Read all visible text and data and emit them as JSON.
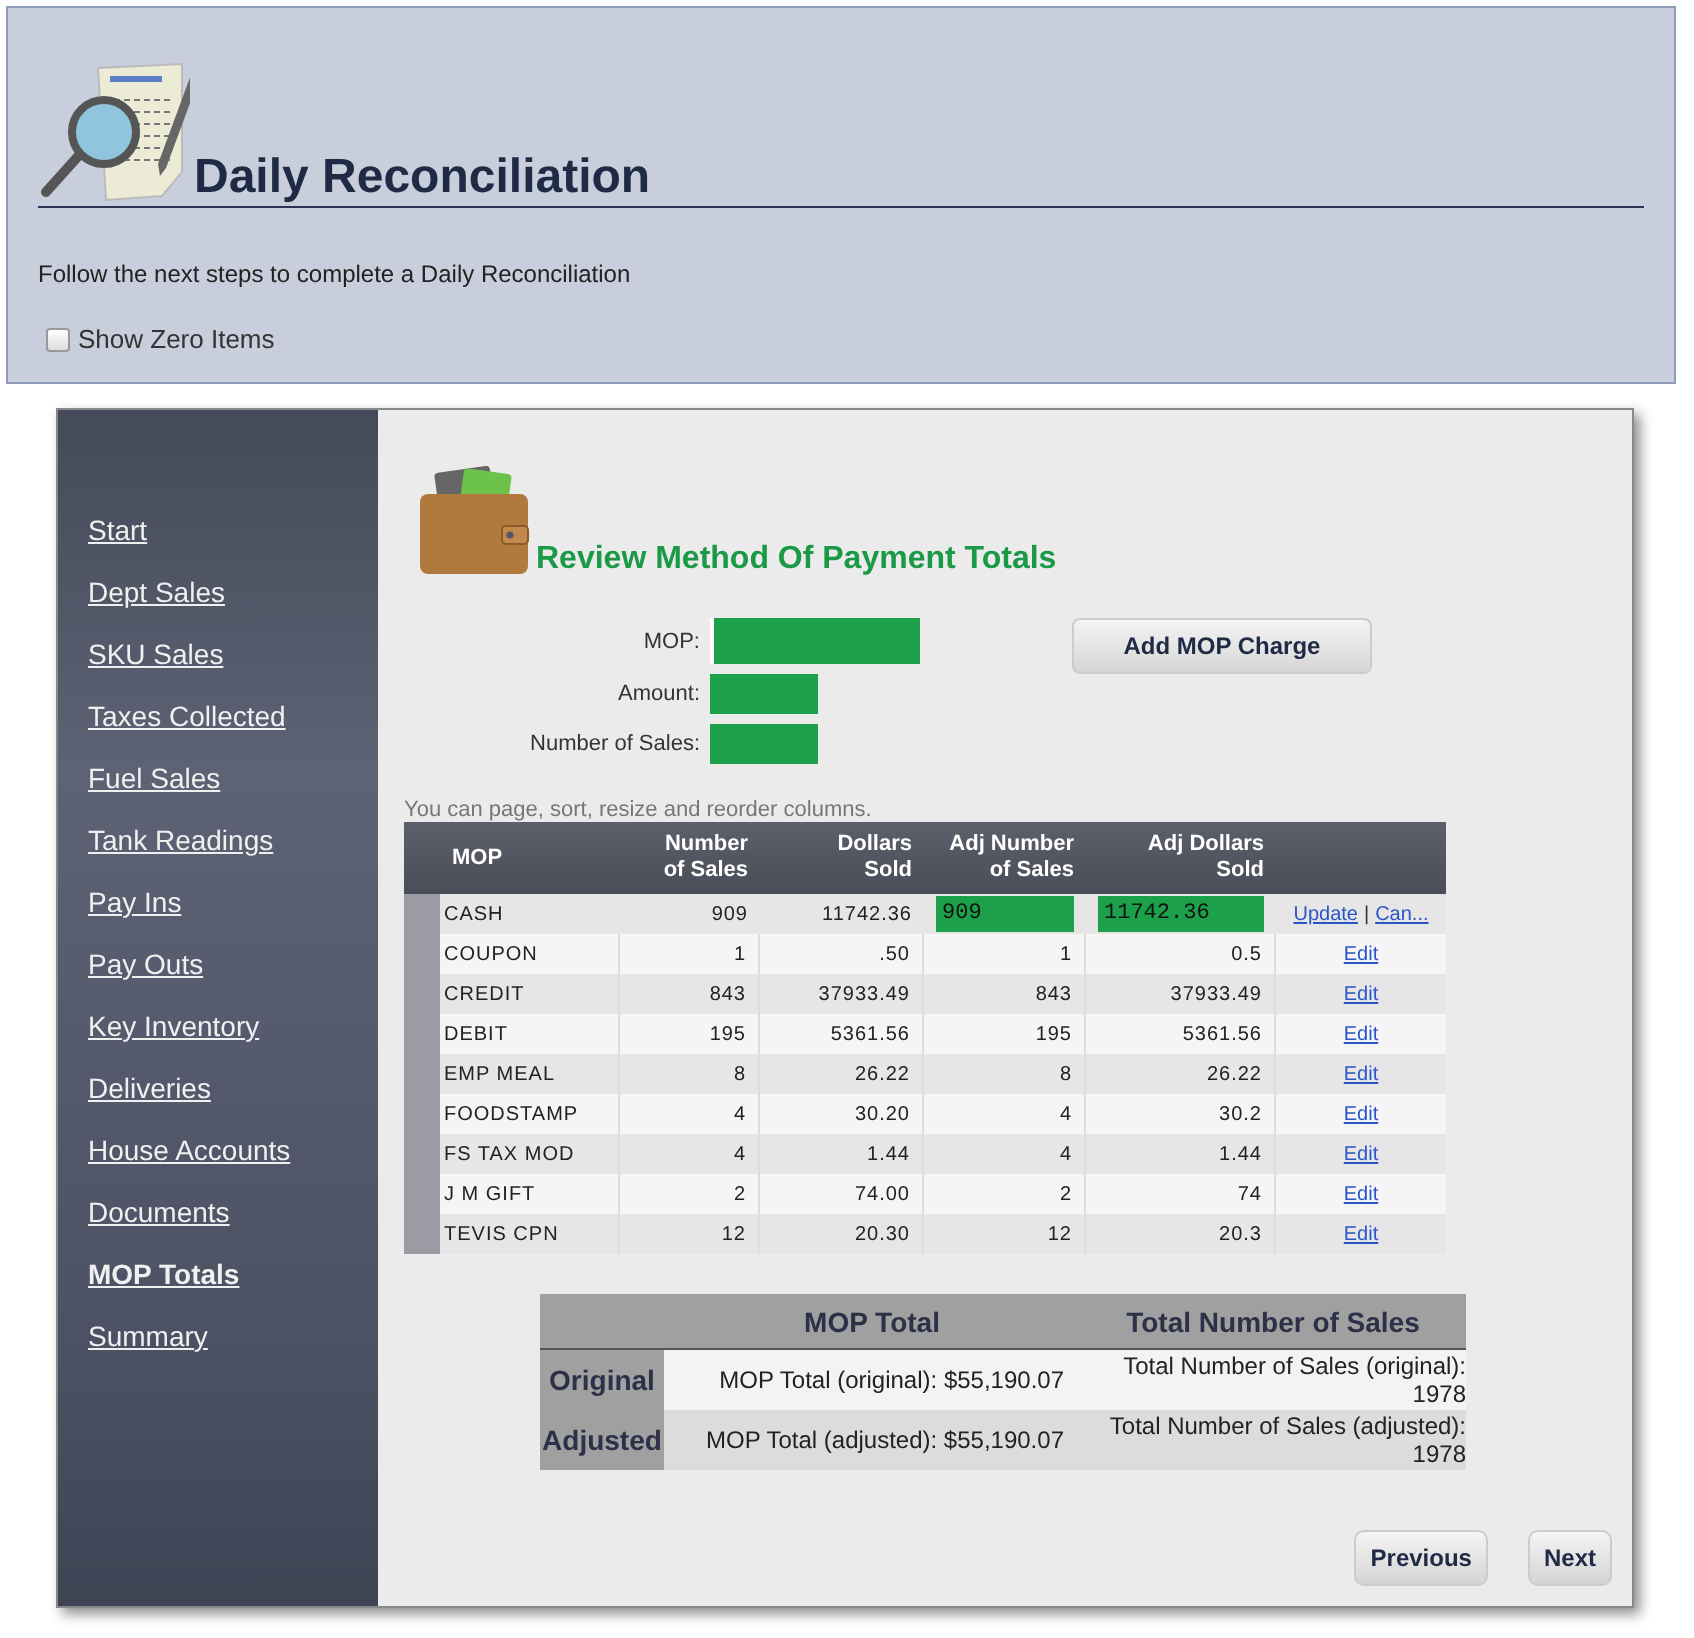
{
  "header": {
    "title": "Daily Reconciliation",
    "description": "Follow the next steps to complete a Daily Reconciliation",
    "show_zero_items": {
      "label": "Show Zero Items",
      "checked": false
    }
  },
  "sidebar": {
    "items": [
      {
        "label": "Start",
        "selected": false
      },
      {
        "label": "Dept Sales",
        "selected": false
      },
      {
        "label": "SKU Sales",
        "selected": false
      },
      {
        "label": "Taxes Collected",
        "selected": false
      },
      {
        "label": "Fuel Sales",
        "selected": false
      },
      {
        "label": "Tank Readings",
        "selected": false
      },
      {
        "label": "Pay Ins",
        "selected": false
      },
      {
        "label": "Pay Outs",
        "selected": false
      },
      {
        "label": "Key Inventory",
        "selected": false
      },
      {
        "label": "Deliveries",
        "selected": false
      },
      {
        "label": "House Accounts",
        "selected": false
      },
      {
        "label": "Documents",
        "selected": false
      },
      {
        "label": "MOP Totals",
        "selected": true
      },
      {
        "label": "Summary",
        "selected": false
      }
    ]
  },
  "section_title": "Review Method Of Payment Totals",
  "form": {
    "fields": [
      {
        "label": "MOP:"
      },
      {
        "label": "Amount:"
      },
      {
        "label": "Number of Sales:"
      }
    ],
    "add_button": "Add MOP Charge"
  },
  "grid_hint": "You can page, sort, resize and reorder columns.",
  "table": {
    "columns": [
      "MOP",
      "Number\nof Sales",
      "Dollars\nSold",
      "Adj Number\nof Sales",
      "Adj Dollars\nSold"
    ],
    "rows": [
      {
        "mop": "CASH",
        "number": "909",
        "dollars": "11742.36",
        "adj_number": "909",
        "adj_dollars": "11742.36",
        "editing": true,
        "actions": [
          {
            "kind": "link",
            "text": "Update"
          },
          {
            "kind": "separator",
            "text": "|"
          },
          {
            "kind": "link",
            "text": "Can..."
          }
        ]
      },
      {
        "mop": "COUPON",
        "number": "1",
        "dollars": ".50",
        "adj_number": "1",
        "adj_dollars": "0.5",
        "editing": false,
        "actions": [
          "Edit"
        ]
      },
      {
        "mop": "CREDIT",
        "number": "843",
        "dollars": "37933.49",
        "adj_number": "843",
        "adj_dollars": "37933.49",
        "editing": false,
        "actions": [
          "Edit"
        ]
      },
      {
        "mop": "DEBIT",
        "number": "195",
        "dollars": "5361.56",
        "adj_number": "195",
        "adj_dollars": "5361.56",
        "editing": false,
        "actions": [
          "Edit"
        ]
      },
      {
        "mop": "EMP MEAL",
        "number": "8",
        "dollars": "26.22",
        "adj_number": "8",
        "adj_dollars": "26.22",
        "editing": false,
        "actions": [
          "Edit"
        ]
      },
      {
        "mop": "FOODSTAMP",
        "number": "4",
        "dollars": "30.20",
        "adj_number": "4",
        "adj_dollars": "30.2",
        "editing": false,
        "actions": [
          "Edit"
        ]
      },
      {
        "mop": "FS TAX MOD",
        "number": "4",
        "dollars": "1.44",
        "adj_number": "4",
        "adj_dollars": "1.44",
        "editing": false,
        "actions": [
          "Edit"
        ]
      },
      {
        "mop": "J M GIFT",
        "number": "2",
        "dollars": "74.00",
        "adj_number": "2",
        "adj_dollars": "74",
        "editing": false,
        "actions": [
          "Edit"
        ]
      },
      {
        "mop": "TEVIS CPN",
        "number": "12",
        "dollars": "20.30",
        "adj_number": "12",
        "adj_dollars": "20.3",
        "editing": false,
        "actions": [
          "Edit"
        ]
      }
    ]
  },
  "summary": {
    "columns": [
      "MOP Total",
      "Total Number of Sales"
    ],
    "rows": [
      {
        "label": "Original",
        "mop_total": "MOP Total (original): $55,190.07",
        "sales_total": "Total Number of Sales (original):\n1978"
      },
      {
        "label": "Adjusted",
        "mop_total": "MOP Total (adjusted): $55,190.07",
        "sales_total": "Total Number of Sales (adjusted):\n1978"
      }
    ]
  },
  "buttons": [
    "Previous",
    "Next"
  ]
}
